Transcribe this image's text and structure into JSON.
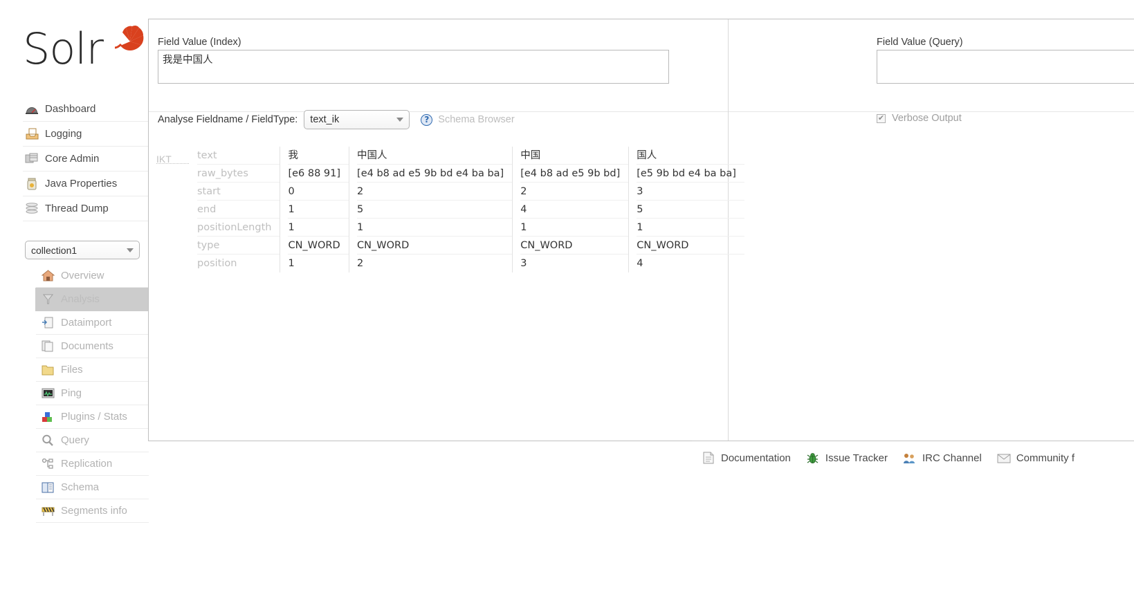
{
  "brand": {
    "name": "Solr",
    "logo_icon": "solr-sunburst-logo"
  },
  "sidebar": {
    "top_items": [
      {
        "label": "Dashboard",
        "icon": "dashboard-gauge-icon"
      },
      {
        "label": "Logging",
        "icon": "logging-tray-icon"
      },
      {
        "label": "Core Admin",
        "icon": "core-admin-database-icon"
      },
      {
        "label": "Java Properties",
        "icon": "java-properties-jar-icon"
      },
      {
        "label": "Thread Dump",
        "icon": "thread-dump-stack-icon"
      }
    ],
    "core_selector": {
      "value": "collection1",
      "caret_icon": "chevron-down-icon"
    },
    "core_items": [
      {
        "label": "Overview",
        "icon": "overview-home-icon",
        "active": false
      },
      {
        "label": "Analysis",
        "icon": "analysis-funnel-icon",
        "active": true
      },
      {
        "label": "Dataimport",
        "icon": "dataimport-page-icon",
        "active": false
      },
      {
        "label": "Documents",
        "icon": "documents-pages-icon",
        "active": false
      },
      {
        "label": "Files",
        "icon": "files-folder-icon",
        "active": false
      },
      {
        "label": "Ping",
        "icon": "ping-monitor-icon",
        "active": false
      },
      {
        "label": "Plugins / Stats",
        "icon": "plugins-blocks-icon",
        "active": false
      },
      {
        "label": "Query",
        "icon": "query-magnifier-icon",
        "active": false
      },
      {
        "label": "Replication",
        "icon": "replication-nodes-icon",
        "active": false
      },
      {
        "label": "Schema",
        "icon": "schema-book-icon",
        "active": false
      },
      {
        "label": "Segments info",
        "icon": "segments-barrier-icon",
        "active": false
      }
    ]
  },
  "analysis": {
    "index_label": "Field Value (Index)",
    "index_value": "我是中国人",
    "index_placeholder": "",
    "query_label": "Field Value (Query)",
    "query_value": "",
    "query_placeholder": "",
    "analyse_label": "Analyse Fieldname / FieldType:",
    "fieldtype_value": "text_ik",
    "schema_browser_label": "Schema Browser",
    "help_icon": "question-mark-icon",
    "verbose_label": "Verbose Output",
    "verbose_checked": true,
    "checkmark_glyph": "✔"
  },
  "results": {
    "analyzer": "IKT",
    "row_labels": [
      "text",
      "raw_bytes",
      "start",
      "end",
      "positionLength",
      "type",
      "position"
    ],
    "tokens": [
      {
        "text": "我",
        "raw_bytes": "[e6 88 91]",
        "start": "0",
        "end": "1",
        "positionLength": "1",
        "type": "CN_WORD",
        "position": "1"
      },
      {
        "text": "中国人",
        "raw_bytes": "[e4 b8 ad e5 9b bd e4 ba ba]",
        "start": "2",
        "end": "5",
        "positionLength": "1",
        "type": "CN_WORD",
        "position": "2"
      },
      {
        "text": "中国",
        "raw_bytes": "[e4 b8 ad e5 9b bd]",
        "start": "2",
        "end": "4",
        "positionLength": "1",
        "type": "CN_WORD",
        "position": "3"
      },
      {
        "text": "国人",
        "raw_bytes": "[e5 9b bd e4 ba ba]",
        "start": "3",
        "end": "5",
        "positionLength": "1",
        "type": "CN_WORD",
        "position": "4"
      }
    ]
  },
  "footer": {
    "links": [
      {
        "label": "Documentation",
        "icon": "documentation-page-icon"
      },
      {
        "label": "Issue Tracker",
        "icon": "issue-tracker-bug-icon"
      },
      {
        "label": "IRC Channel",
        "icon": "irc-channel-people-icon"
      },
      {
        "label": "Community f",
        "icon": "community-forum-envelope-icon"
      }
    ]
  },
  "colors": {
    "brand_red": "#d9411e",
    "active_bg": "#cccccc",
    "link_blue": "#2f6ab0"
  }
}
